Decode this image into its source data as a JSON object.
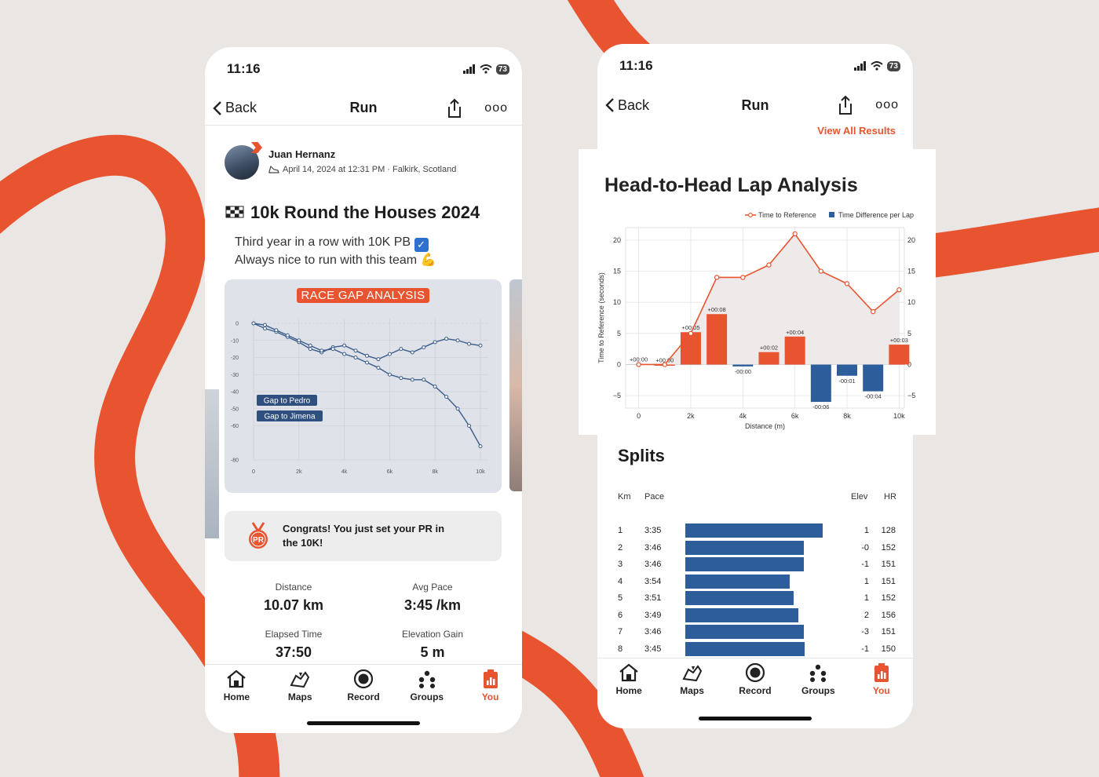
{
  "colors": {
    "accent": "#e8542f",
    "bar_blue": "#2d5d9a",
    "line_blue": "#3a5d8c",
    "background": "#e9e6e4"
  },
  "status": {
    "time": "11:16",
    "battery": "73"
  },
  "nav": {
    "back": "Back",
    "title": "Run",
    "share_icon": "share-icon",
    "more_icon": "more-icon",
    "more_glyph": "ooo"
  },
  "tabs": [
    {
      "label": "Home",
      "icon": "home-icon"
    },
    {
      "label": "Maps",
      "icon": "maps-icon"
    },
    {
      "label": "Record",
      "icon": "record-icon"
    },
    {
      "label": "Groups",
      "icon": "groups-icon"
    },
    {
      "label": "You",
      "icon": "you-icon",
      "active": true
    }
  ],
  "activity": {
    "athlete": "Juan Hernanz",
    "meta": "April 14, 2024 at 12:31 PM · Falkirk, Scotland",
    "title": "10k Round the Houses 2024",
    "desc_line1": "Third year in a row with 10K PB",
    "desc_line2": "Always nice to run with this team",
    "pr_message": "Congrats! You just set your PR in the 10K!",
    "pr_badge": "PR",
    "stats": [
      {
        "label": "Distance",
        "value": "10.07 km"
      },
      {
        "label": "Avg Pace",
        "value": "3:45 /km"
      },
      {
        "label": "Elapsed Time",
        "value": "37:50"
      },
      {
        "label": "Elevation Gain",
        "value": "5 m"
      }
    ]
  },
  "view_all": "View All Results",
  "splits": {
    "title": "Splits",
    "headers": {
      "km": "Km",
      "pace": "Pace",
      "elev": "Elev",
      "hr": "HR"
    },
    "rows": [
      {
        "km": "1",
        "pace": "3:35",
        "elev": "1",
        "hr": "128",
        "speed": 1.0
      },
      {
        "km": "2",
        "pace": "3:46",
        "elev": "-0",
        "hr": "152",
        "speed": 0.86
      },
      {
        "km": "3",
        "pace": "3:46",
        "elev": "-1",
        "hr": "151",
        "speed": 0.86
      },
      {
        "km": "4",
        "pace": "3:54",
        "elev": "1",
        "hr": "151",
        "speed": 0.76
      },
      {
        "km": "5",
        "pace": "3:51",
        "elev": "1",
        "hr": "152",
        "speed": 0.79
      },
      {
        "km": "6",
        "pace": "3:49",
        "elev": "2",
        "hr": "156",
        "speed": 0.82
      },
      {
        "km": "7",
        "pace": "3:46",
        "elev": "-3",
        "hr": "151",
        "speed": 0.86
      },
      {
        "km": "8",
        "pace": "3:45",
        "elev": "-1",
        "hr": "150",
        "speed": 0.87
      }
    ]
  },
  "chart_data": [
    {
      "type": "line",
      "title": "RACE GAP ANALYSIS",
      "xlim": [
        0,
        10000
      ],
      "ylim": [
        -80,
        0
      ],
      "xticks": [
        0,
        2000,
        4000,
        6000,
        8000,
        10000
      ],
      "xtick_labels": [
        "0",
        "2k",
        "4k",
        "6k",
        "8k",
        "10k"
      ],
      "yticks": [
        0,
        -10,
        -20,
        -30,
        -40,
        -50,
        -60,
        -80
      ],
      "ytick_labels": [
        "0",
        "-10",
        "-20",
        "-30",
        "-40",
        "-50",
        "-60",
        "-80"
      ],
      "legend": [
        "Gap to Pedro",
        "Gap to Jimena"
      ],
      "series": [
        {
          "name": "Gap to Pedro",
          "x": [
            0,
            500,
            1000,
            1500,
            2000,
            2500,
            3000,
            3500,
            4000,
            4500,
            5000,
            5500,
            6000,
            6500,
            7000,
            7500,
            8000,
            8500,
            9000,
            9500,
            10000
          ],
          "y": [
            0,
            -3,
            -5,
            -8,
            -11,
            -15,
            -17,
            -14,
            -13,
            -16,
            -19,
            -21,
            -18,
            -15,
            -17,
            -14,
            -11,
            -9,
            -10,
            -12,
            -13
          ]
        },
        {
          "name": "Gap to Jimena",
          "x": [
            0,
            500,
            1000,
            1500,
            2000,
            2500,
            3000,
            3500,
            4000,
            4500,
            5000,
            5500,
            6000,
            6500,
            7000,
            7500,
            8000,
            8500,
            9000,
            9500,
            10000
          ],
          "y": [
            0,
            -1,
            -4,
            -7,
            -10,
            -13,
            -16,
            -15,
            -18,
            -20,
            -23,
            -26,
            -30,
            -32,
            -33,
            -33,
            -37,
            -43,
            -50,
            -60,
            -72
          ]
        }
      ]
    },
    {
      "type": "bar",
      "title": "Head-to-Head Lap Analysis",
      "xlabel": "Distance (m)",
      "ylabel": "Time to Reference (seconds)",
      "xlim": [
        -500,
        10200
      ],
      "ylim": [
        -7,
        22
      ],
      "xticks": [
        0,
        2000,
        4000,
        6000,
        8000,
        10000
      ],
      "xtick_labels": [
        "0",
        "2k",
        "4k",
        "6k",
        "8k",
        "10k"
      ],
      "yticks": [
        -5,
        0,
        5,
        10,
        15,
        20
      ],
      "ytick_labels": [
        "−5",
        "0",
        "5",
        "10",
        "15",
        "20"
      ],
      "legend_position": "top-right",
      "series": [
        {
          "name": "Time to Reference",
          "type": "line",
          "x": [
            0,
            1000,
            2000,
            3000,
            4000,
            5000,
            6000,
            7000,
            8000,
            9000,
            10000
          ],
          "y": [
            0,
            0,
            5,
            14,
            14,
            16,
            21,
            15,
            13,
            8.5,
            12
          ]
        },
        {
          "name": "Time Difference per Lap",
          "type": "bar",
          "x": [
            1000,
            2000,
            3000,
            4000,
            5000,
            6000,
            7000,
            8000,
            9000,
            10000
          ],
          "y": [
            0,
            5.2,
            8.1,
            -0.3,
            2,
            4.5,
            -6,
            -1.8,
            -4.3,
            3.2
          ],
          "labels": [
            "+00:00",
            "+00:05",
            "+00:08",
            "-00:00",
            "+00:02",
            "+00:04",
            "-00:06",
            "-00:01",
            "-00:04",
            "+00:03"
          ]
        }
      ],
      "first_point_label": "+00:00"
    }
  ]
}
